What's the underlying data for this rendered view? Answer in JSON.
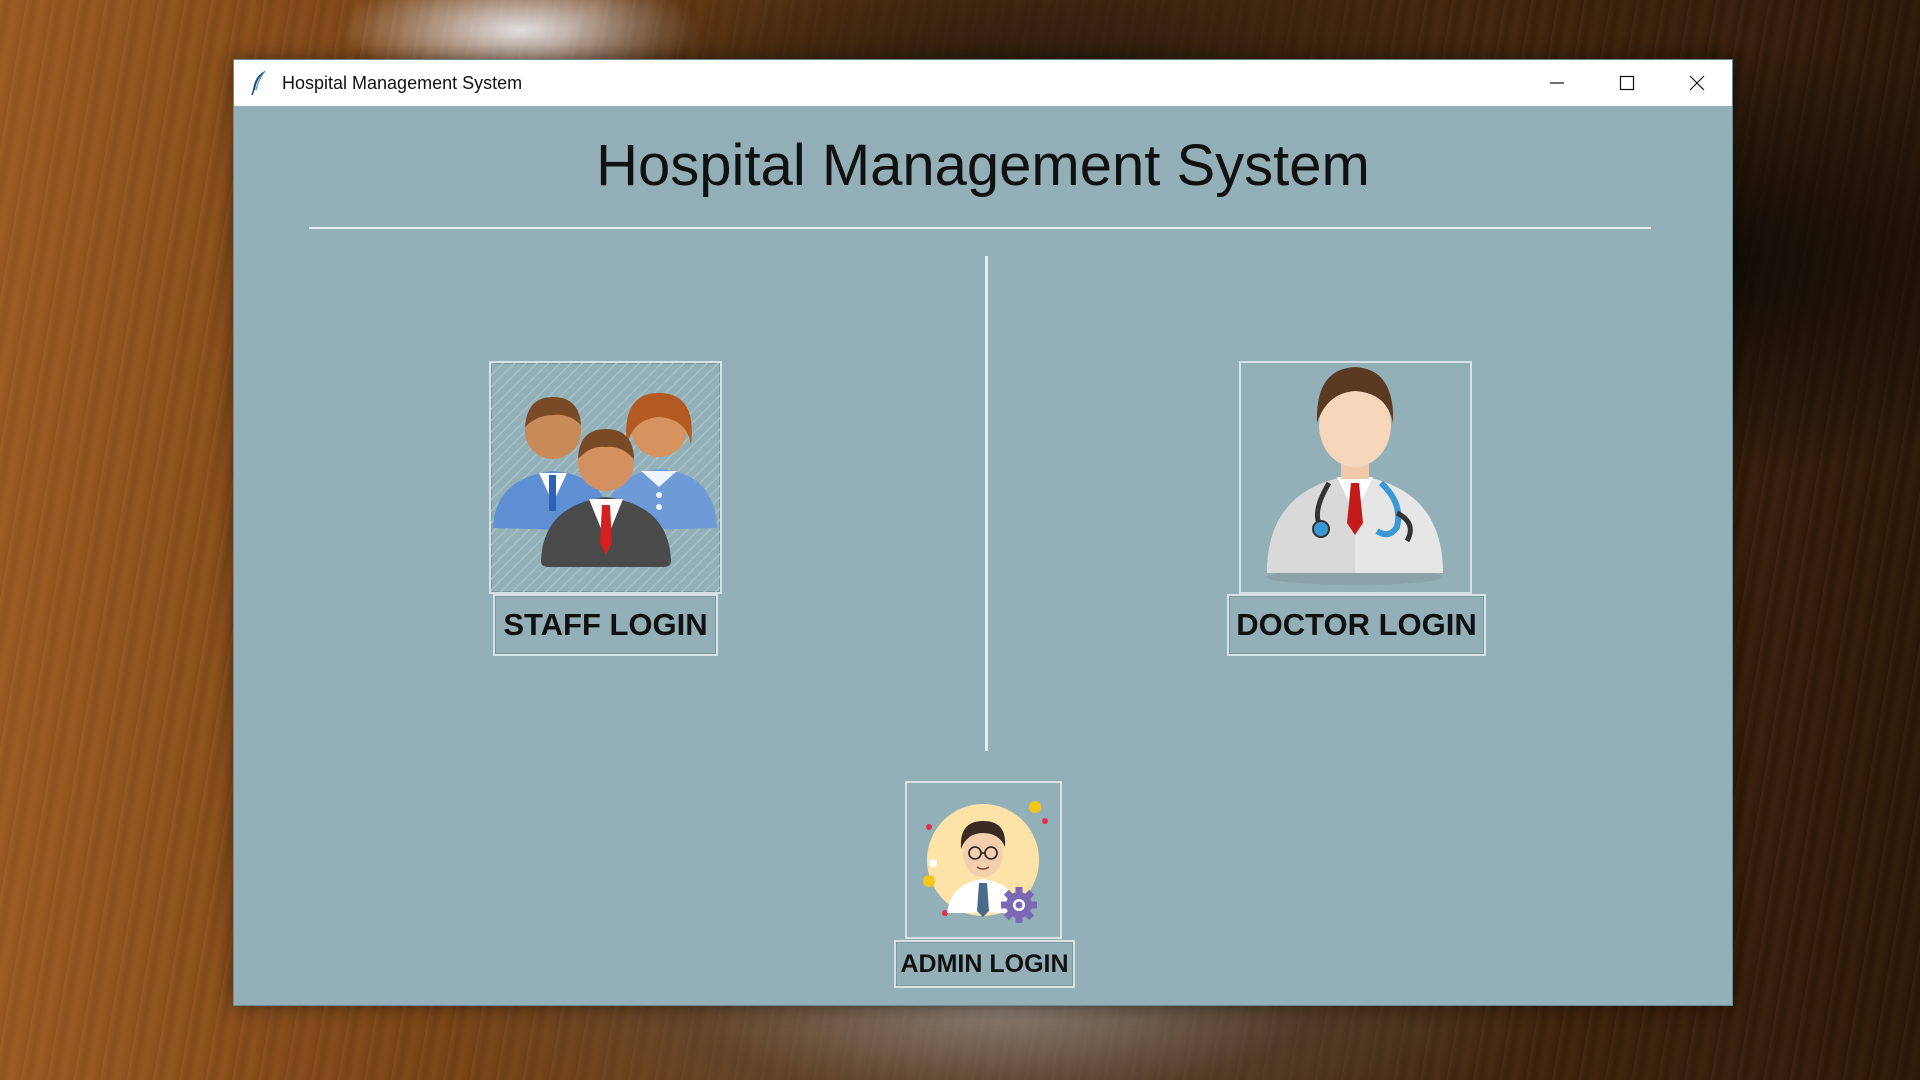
{
  "window": {
    "title": "Hospital Management System",
    "controls": [
      "minimize",
      "maximize",
      "close"
    ]
  },
  "main": {
    "heading": "Hospital Management System",
    "staff": {
      "label": "STAFF LOGIN",
      "icon": "staff-group-icon"
    },
    "doctor": {
      "label": "DOCTOR LOGIN",
      "icon": "doctor-icon"
    },
    "admin": {
      "label": "ADMIN LOGIN",
      "icon": "admin-avatar-icon"
    }
  },
  "colors": {
    "window_bg": "#93b0b8",
    "titlebar_bg": "#ffffff",
    "divider": "#e8eef0"
  }
}
